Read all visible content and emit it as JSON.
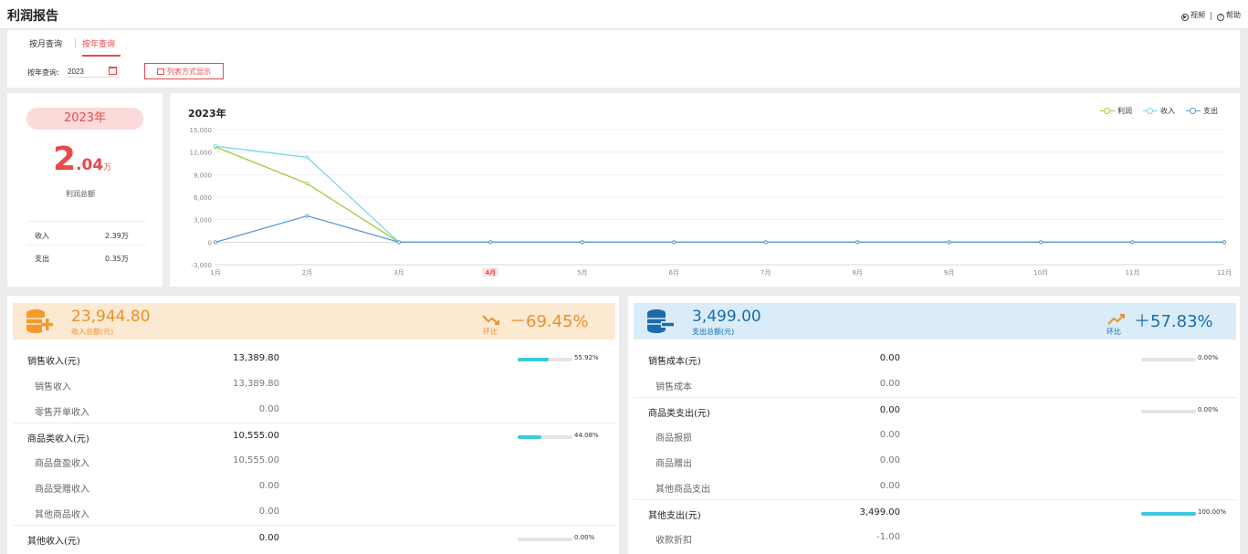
{
  "titlebar": {
    "title": "利润报告",
    "video_label": "视频",
    "help_label": "帮助"
  },
  "query": {
    "tab_month": "按月查询",
    "tab_year": "按年查询",
    "year_label": "按年查询:",
    "year_value": "2023",
    "list_button": "列表方式显示"
  },
  "summary": {
    "year": "2023年",
    "profit_int": "2",
    "profit_dec": ".04",
    "profit_unit": "万",
    "profit_label": "利润总额",
    "income_label": "收入",
    "income_value": "2.39万",
    "expense_label": "支出",
    "expense_value": "0.35万"
  },
  "chart_data": {
    "type": "line",
    "title": "2023年",
    "categories": [
      "1月",
      "2月",
      "3月",
      "4月",
      "5月",
      "6月",
      "7月",
      "8月",
      "9月",
      "10月",
      "11月",
      "12月"
    ],
    "highlight_category": "4月",
    "ylim": [
      -3000,
      15000
    ],
    "yticks": [
      -3000,
      0,
      3000,
      6000,
      9000,
      12000,
      15000
    ],
    "ytick_labels": [
      "-3,000",
      "0",
      "3,000",
      "6,000",
      "9,000",
      "12,000",
      "15,000"
    ],
    "legend_position": "top-right",
    "series": [
      {
        "name": "利润",
        "color": "#9ccc3a",
        "values": [
          12700,
          7800,
          0,
          0,
          0,
          0,
          0,
          0,
          0,
          0,
          0,
          0
        ]
      },
      {
        "name": "收入",
        "color": "#7fd6ec",
        "values": [
          12800,
          11300,
          0,
          0,
          0,
          0,
          0,
          0,
          0,
          0,
          0,
          0
        ]
      },
      {
        "name": "支出",
        "color": "#5b9bd5",
        "values": [
          0,
          3500,
          0,
          0,
          0,
          0,
          0,
          0,
          0,
          0,
          0,
          0
        ]
      }
    ]
  },
  "colors": {
    "accent_red": "#e84a4a",
    "income_orange": "#e8912f",
    "expense_blue": "#1a6cab",
    "bar_cyan": "#3bc9dc"
  },
  "income": {
    "amount": "23,944.80",
    "label": "收入总额(元)",
    "ratio_label": "环比",
    "ratio": "－69.45%",
    "rows": [
      {
        "type": "cat",
        "label": "销售收入(元)",
        "amount": "13,389.80",
        "pct": "55.92%",
        "fraction": 0.5592
      },
      {
        "type": "sub",
        "label": "销售收入",
        "amount": "13,389.80"
      },
      {
        "type": "sub",
        "label": "零售开单收入",
        "amount": "0.00"
      },
      {
        "type": "cat",
        "label": "商品类收入(元)",
        "amount": "10,555.00",
        "pct": "44.08%",
        "fraction": 0.4408
      },
      {
        "type": "sub",
        "label": "商品盘盈收入",
        "amount": "10,555.00"
      },
      {
        "type": "sub",
        "label": "商品受赠收入",
        "amount": "0.00"
      },
      {
        "type": "sub",
        "label": "其他商品收入",
        "amount": "0.00"
      },
      {
        "type": "cat",
        "label": "其他收入(元)",
        "amount": "0.00",
        "pct": "0.00%",
        "fraction": 0
      }
    ]
  },
  "expense": {
    "amount": "3,499.00",
    "label": "支出总额(元)",
    "ratio_label": "环比",
    "ratio": "＋57.83%",
    "rows": [
      {
        "type": "cat",
        "label": "销售成本(元)",
        "amount": "0.00",
        "pct": "0.00%",
        "fraction": 0
      },
      {
        "type": "sub",
        "label": "销售成本",
        "amount": "0.00"
      },
      {
        "type": "cat",
        "label": "商品类支出(元)",
        "amount": "0.00",
        "pct": "0.00%",
        "fraction": 0
      },
      {
        "type": "sub",
        "label": "商品报损",
        "amount": "0.00"
      },
      {
        "type": "sub",
        "label": "商品赠出",
        "amount": "0.00"
      },
      {
        "type": "sub",
        "label": "其他商品支出",
        "amount": "0.00"
      },
      {
        "type": "cat",
        "label": "其他支出(元)",
        "amount": "3,499.00",
        "pct": "100.00%",
        "fraction": 1
      },
      {
        "type": "sub",
        "label": "收款折扣",
        "amount": "-1.00"
      }
    ]
  }
}
